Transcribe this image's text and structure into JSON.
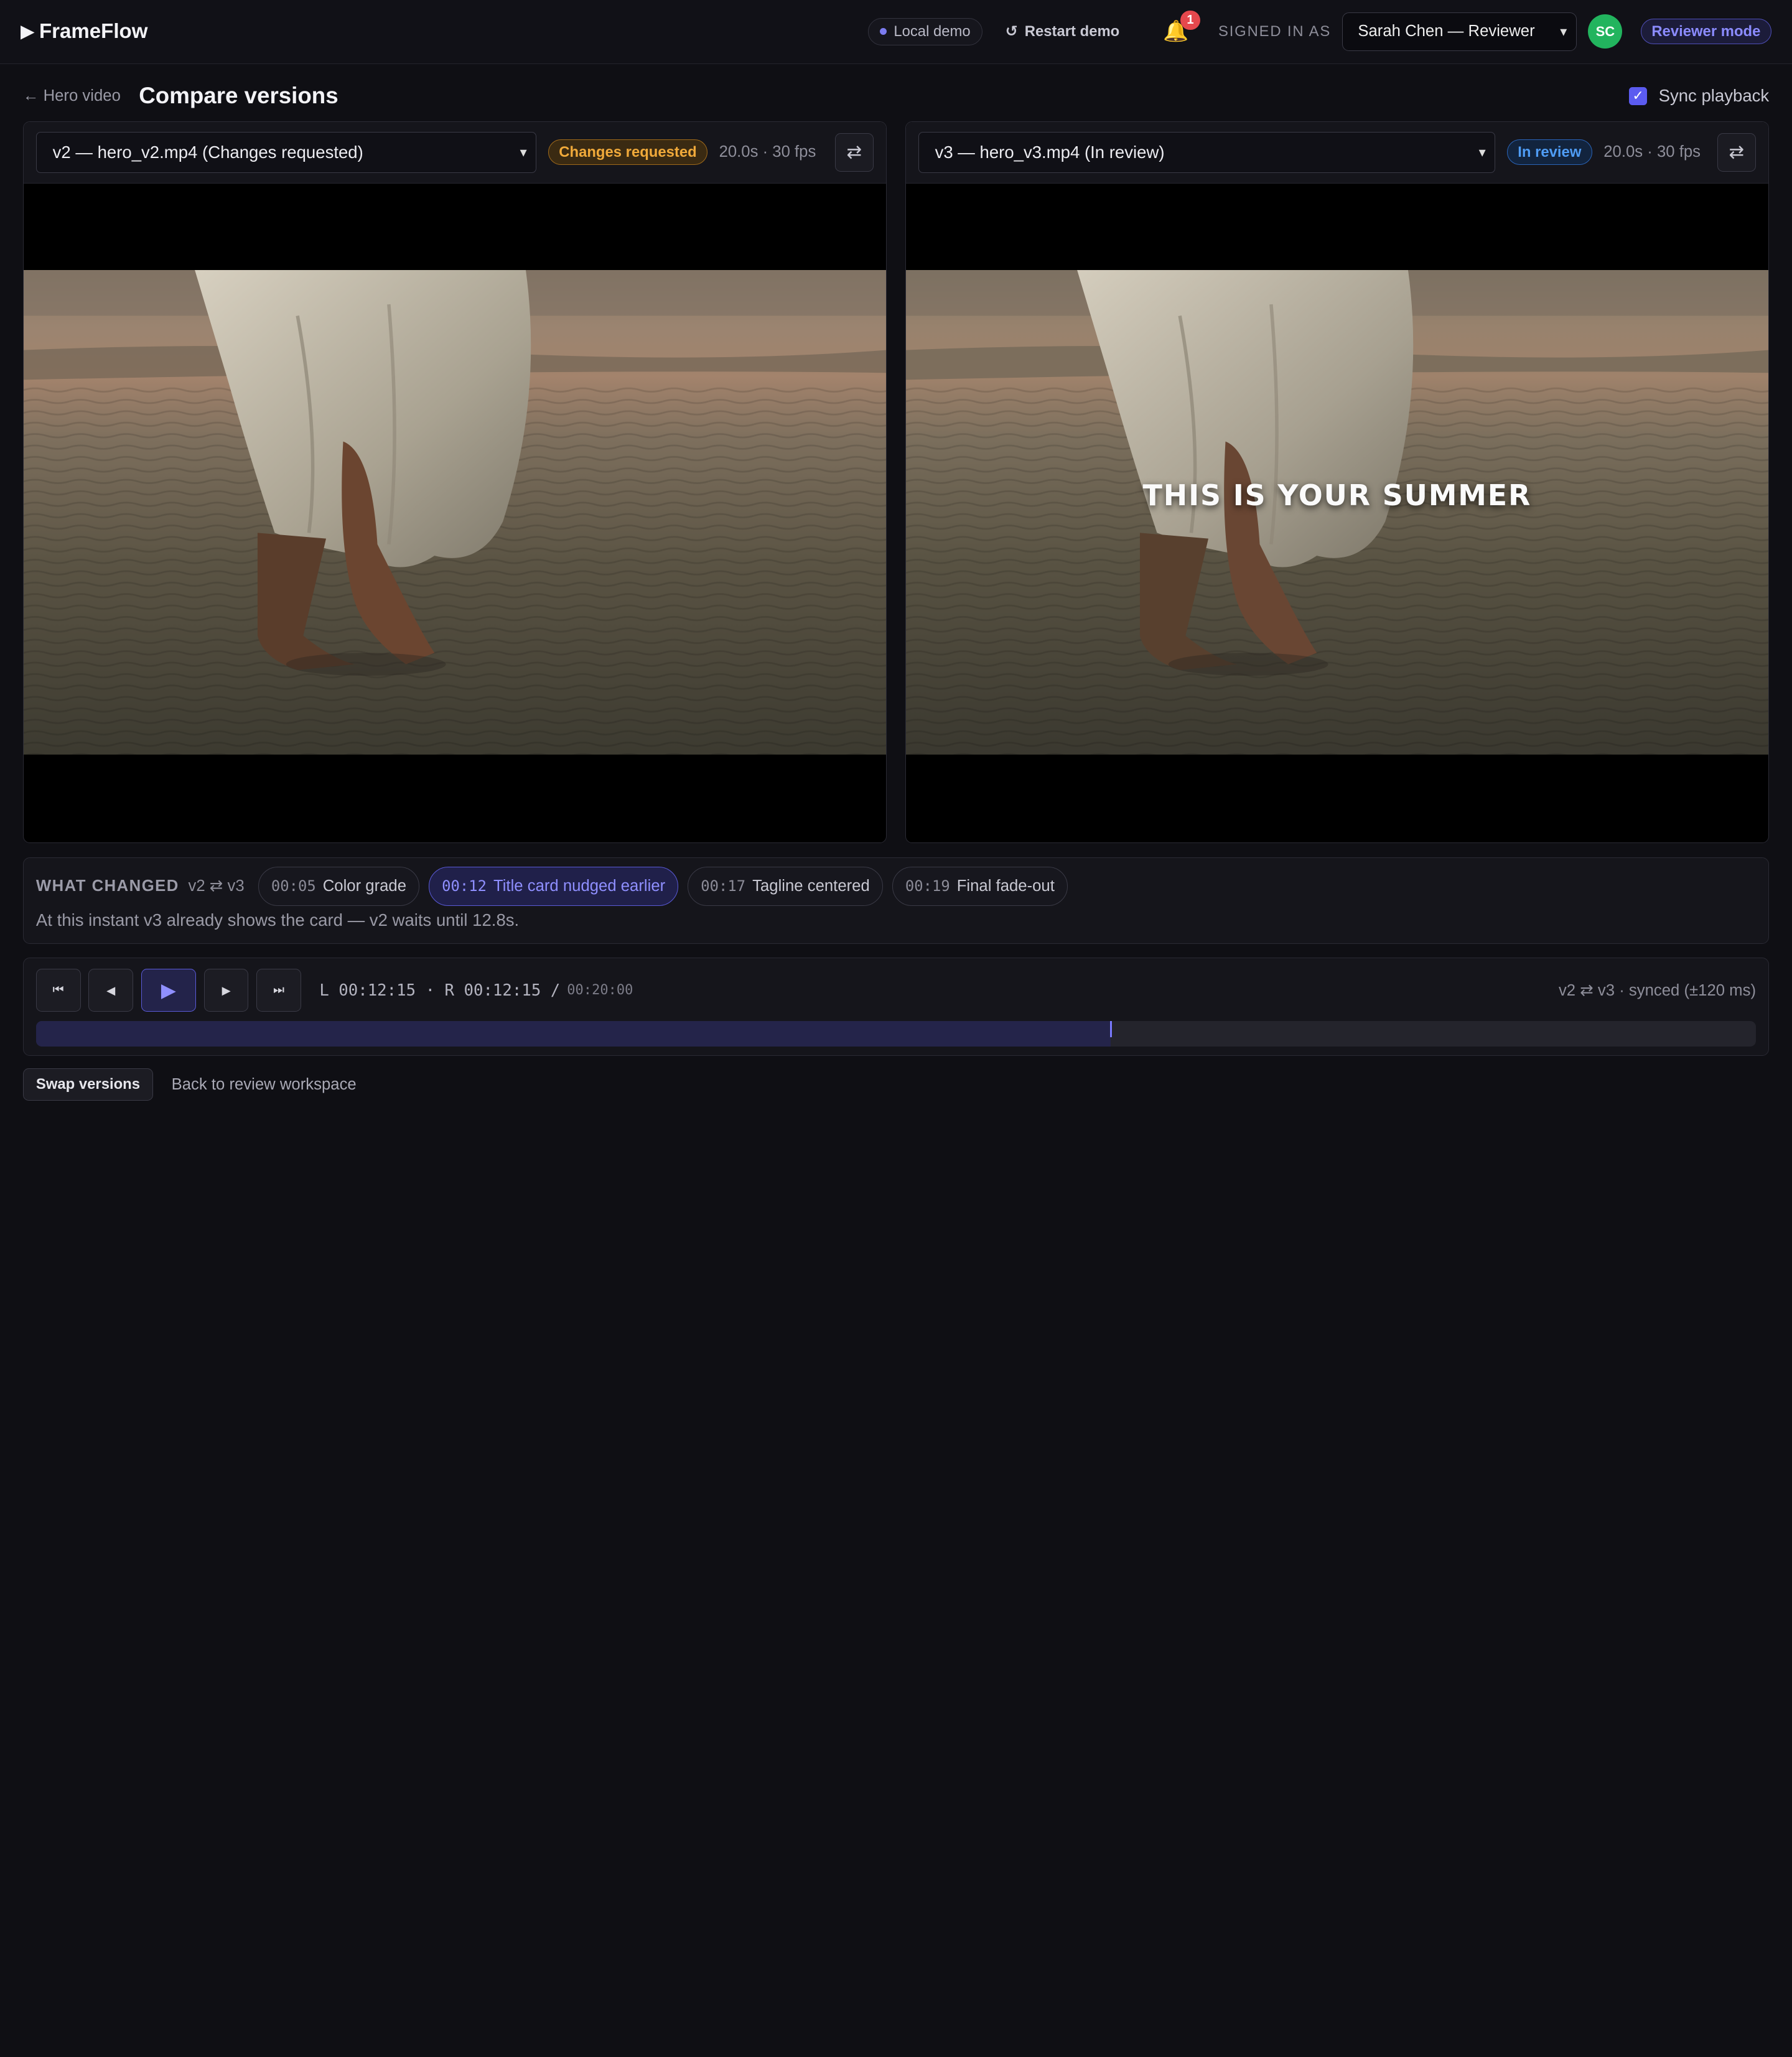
{
  "app": {
    "brand_glyph": "▶",
    "brand": "FrameFlow"
  },
  "topbar": {
    "demo_label": "Local demo",
    "restart_icon": "↺",
    "restart_label": "Restart demo",
    "notification_count": "1",
    "signed_in_label": "SIGNED IN AS",
    "user": "Sarah Chen — Reviewer",
    "avatar_initials": "SC",
    "mode": "Reviewer mode"
  },
  "page": {
    "back_label": "← Hero video",
    "title": "Compare versions",
    "sync_label": "Sync playback",
    "sync_checked": true
  },
  "left": {
    "version": "v2 — hero_v2.mp4 (Changes requested)",
    "status": "Changes requested",
    "meta": "20.0s · 30 fps",
    "swap_icon": "⇄",
    "overlay": ""
  },
  "right": {
    "version": "v3 — hero_v3.mp4 (In review)",
    "status": "In review",
    "meta": "20.0s · 30 fps",
    "swap_icon": "⇄",
    "overlay": "THIS IS YOUR SUMMER"
  },
  "changes": {
    "label": "WHAT CHANGED",
    "pair": "v2 ⇄ v3",
    "items": [
      {
        "tc": "00:05",
        "label": "Color grade"
      },
      {
        "tc": "00:12",
        "label": "Title card nudged earlier"
      },
      {
        "tc": "00:17",
        "label": "Tagline centered"
      },
      {
        "tc": "00:19",
        "label": "Final fade-out"
      }
    ],
    "active_index": 1,
    "note": "At this instant v3 already shows the card — v2 waits until 12.8s."
  },
  "transport": {
    "icons": {
      "to_start": "⏮",
      "prev": "◀",
      "play": "▶",
      "next": "▶",
      "to_end": "⏭"
    },
    "left_tc_label": "L",
    "left_tc": "00:12:15",
    "separator": "·",
    "right_tc_label": "R",
    "right_tc": "00:12:15",
    "total_sep": "/",
    "total": "00:20:00",
    "sync_status": "v2 ⇄ v3 · synced (±120 ms)",
    "progress_fraction": 0.625
  },
  "footer": {
    "swap_label": "Swap versions",
    "back_label": "Back to review workspace"
  },
  "colors": {
    "accent": "#5b5bf0",
    "changes_requested": "#f0a93a",
    "in_review": "#4f9cf4",
    "avatar": "#22b45e"
  }
}
